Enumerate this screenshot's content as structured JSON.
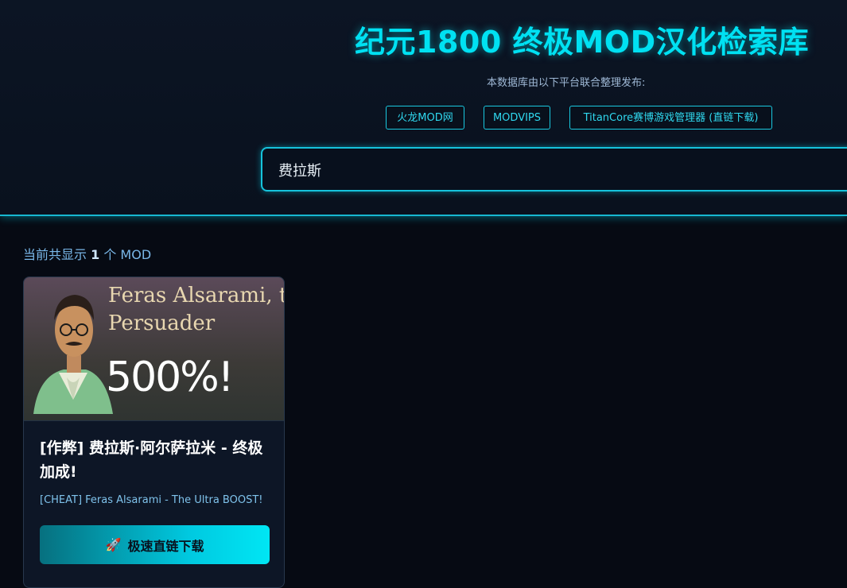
{
  "header": {
    "title": "纪元1800 终极MOD汉化检索库",
    "subtitle": "本数据库由以下平台联合整理发布:",
    "platforms": [
      {
        "label": "火龙MOD网"
      },
      {
        "label": "MODVIPS"
      },
      {
        "label": "TitanCore赛博游戏管理器 (直链下载)"
      }
    ]
  },
  "search": {
    "value": "费拉斯",
    "placeholder": ""
  },
  "results": {
    "count_prefix": "当前共显示",
    "count": "1",
    "count_suffix": "个 MOD"
  },
  "cards": [
    {
      "image_title_line1": "Feras Alsarami, the",
      "image_title_line2": "Persuader",
      "image_percent": "500%!",
      "title": "[作弊] 费拉斯·阿尔萨拉米 - 终极加成!",
      "subtitle": "[CHEAT] Feras Alsarami - The Ultra BOOST!",
      "download_icon": "rocket-icon",
      "download_label": "极速直链下载"
    }
  ],
  "colors": {
    "accent": "#00e1f2",
    "background": "#060a13",
    "header_bg": "#0c1524",
    "link_border": "#19c9e0"
  }
}
